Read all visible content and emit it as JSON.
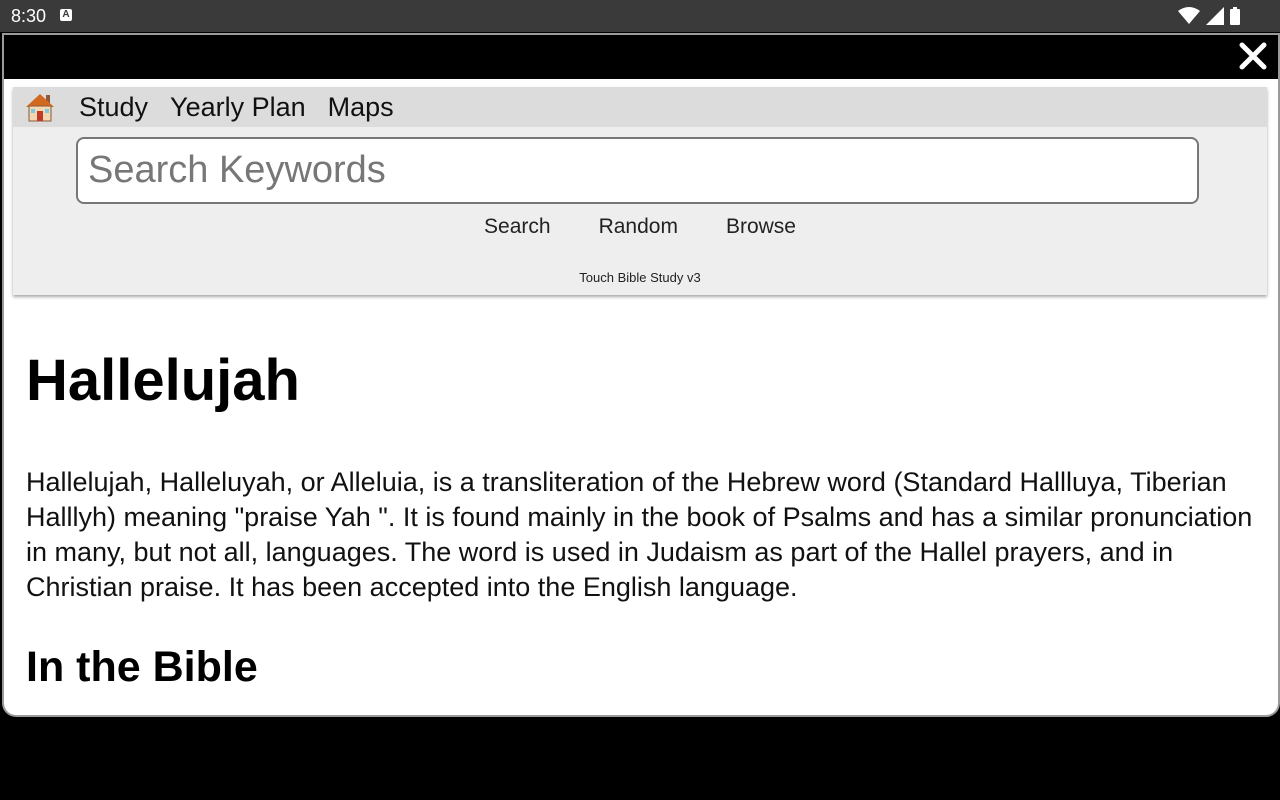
{
  "status_bar": {
    "time": "8:30",
    "notification_badge": "A"
  },
  "menu": {
    "home_icon": "house-icon",
    "items": [
      "Study",
      "Yearly Plan",
      "Maps"
    ]
  },
  "search": {
    "placeholder": "Search Keywords",
    "value": ""
  },
  "actions": {
    "search_label": "Search",
    "random_label": "Random",
    "browse_label": "Browse"
  },
  "app_version": "Touch Bible Study v3",
  "article": {
    "title": "Hallelujah",
    "body": "Hallelujah, Halleluyah, or Alleluia, is a transliteration of the Hebrew word (Standard Hallluya, Tiberian Halllyh) meaning \"praise Yah \". It is found mainly in the book of Psalms and has a similar pronunciation in many, but not all, languages. The word is used in Judaism as part of the Hallel prayers, and in Christian praise. It has been accepted into the English language.",
    "section_heading": "In the Bible"
  },
  "colors": {
    "status_bar_bg": "#3a3a3a",
    "dialog_header_bg": "#000000",
    "menu_bar_bg": "#dcdcdc",
    "nav_panel_bg": "#eeeeee"
  }
}
